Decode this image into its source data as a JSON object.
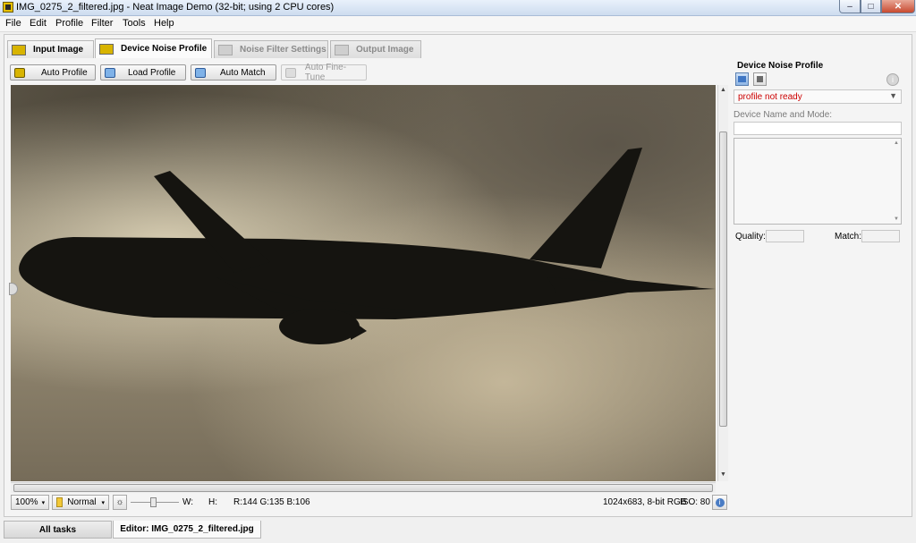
{
  "window": {
    "title": "IMG_0275_2_filtered.jpg - Neat Image Demo (32-bit; using 2 CPU cores)",
    "min_glyph": "–",
    "max_glyph": "□",
    "close_glyph": "✕"
  },
  "menu": [
    "File",
    "Edit",
    "Profile",
    "Filter",
    "Tools",
    "Help"
  ],
  "tabs": [
    {
      "label": "Input Image",
      "icon": "input-image-icon",
      "state": "normal"
    },
    {
      "label": "Device Noise Profile",
      "icon": "device-noise-profile-icon",
      "state": "active"
    },
    {
      "label": "Noise Filter Settings",
      "icon": "noise-filter-icon",
      "state": "disabled"
    },
    {
      "label": "Output Image",
      "icon": "output-image-icon",
      "state": "disabled"
    }
  ],
  "toolbar": {
    "auto_profile": "Auto Profile",
    "load_profile": "Load Profile",
    "auto_match": "Auto Match",
    "auto_fine_tune": "Auto Fine-Tune"
  },
  "status": {
    "zoom": "100%",
    "mode": "Normal",
    "w_label": "W:",
    "h_label": "H:",
    "rgb": "R:144 G:135 B:106",
    "image_info": "1024x683, 8-bit RGB",
    "iso": "ISO: 80"
  },
  "profile_panel": {
    "title": "Device Noise Profile",
    "status": "profile not ready",
    "device_label": "Device Name and Mode:",
    "device_value": "",
    "quality_label": "Quality:",
    "match_label": "Match:"
  },
  "bottom_tabs": {
    "all_tasks": "All tasks",
    "editor": "Editor: IMG_0275_2_filtered.jpg"
  },
  "colors": {
    "status_text": "#cc0000",
    "accent_icon": "#d8b400"
  }
}
